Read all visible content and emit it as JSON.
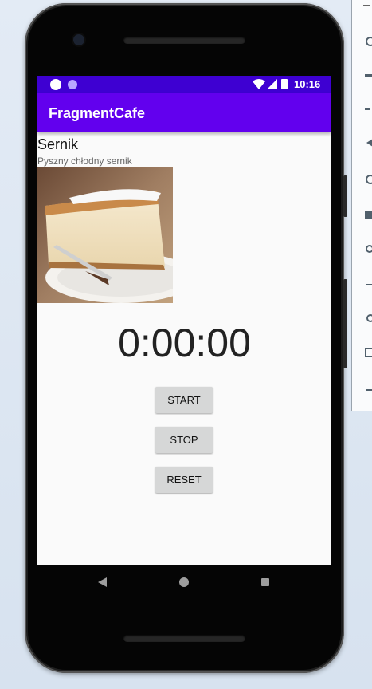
{
  "status_bar": {
    "time": "10:16"
  },
  "app_bar": {
    "title": "FragmentCafe"
  },
  "cake": {
    "title": "Sernik",
    "description": "Pyszny chłodny sernik"
  },
  "stopwatch": {
    "time": "0:00:00",
    "start_label": "START",
    "stop_label": "STOP",
    "reset_label": "RESET"
  },
  "toolbar": {
    "icons": [
      "power-icon",
      "volume-up-icon",
      "volume-down-icon",
      "rotate-left-icon",
      "rotate-right-icon",
      "camera-icon",
      "zoom-icon",
      "back-icon",
      "home-icon",
      "overview-icon",
      "more-icon"
    ]
  },
  "colors": {
    "status_bar": "#3e00d2",
    "app_bar": "#6200ee",
    "screen_bg": "#fafafa",
    "button": "#d6d7d7"
  }
}
